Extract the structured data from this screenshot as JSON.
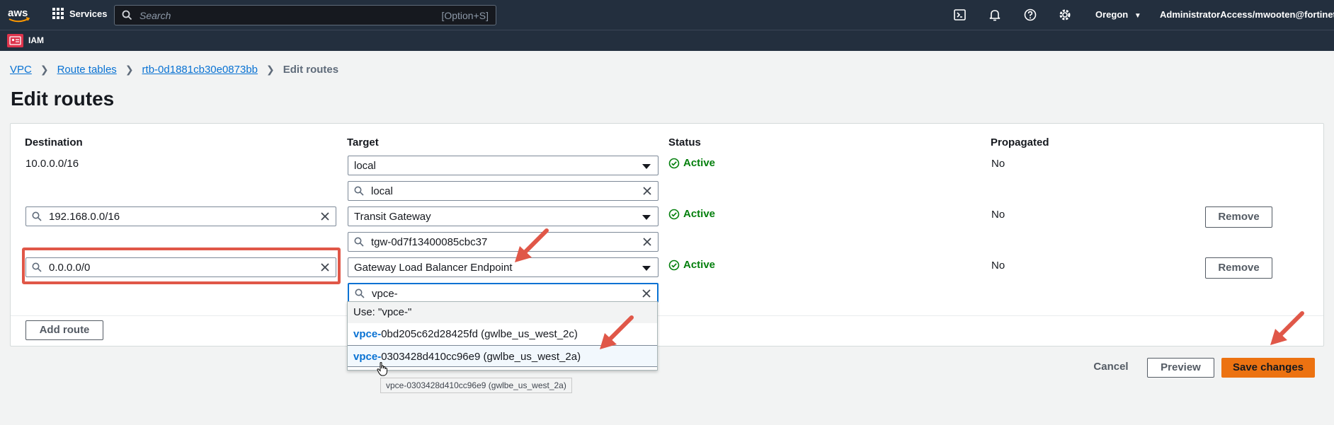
{
  "topnav": {
    "logo_text": "aws",
    "services_label": "Services",
    "search_placeholder": "Search",
    "search_shortcut": "[Option+S]",
    "region": "Oregon",
    "account": "AdministratorAccess/mwooten@fortinet.com"
  },
  "subnav": {
    "service_label": "IAM"
  },
  "breadcrumb": {
    "items": [
      "VPC",
      "Route tables",
      "rtb-0d1881cb30e0873bb"
    ],
    "current": "Edit routes"
  },
  "page_title": "Edit routes",
  "table": {
    "headers": {
      "destination": "Destination",
      "target": "Target",
      "status": "Status",
      "propagated": "Propagated"
    },
    "rows": [
      {
        "destination": "10.0.0.0/16",
        "target": "local",
        "target_search": "local",
        "status": "Active",
        "propagated": "No"
      },
      {
        "destination": "192.168.0.0/16",
        "target": "Transit Gateway",
        "target_search": "tgw-0d7f13400085cbc37",
        "status": "Active",
        "propagated": "No",
        "remove_label": "Remove"
      },
      {
        "destination": "0.0.0.0/0",
        "target": "Gateway Load Balancer Endpoint",
        "target_search": "vpce-",
        "status": "Active",
        "propagated": "No",
        "remove_label": "Remove"
      }
    ],
    "add_route_label": "Add route"
  },
  "dropdown": {
    "use_option": "Use: \"vpce-\"",
    "options": [
      {
        "match": "vpce-",
        "rest": "0bd205c62d28425fd (gwlbe_us_west_2c)"
      },
      {
        "match": "vpce-",
        "rest": "0303428d410cc96e9 (gwlbe_us_west_2a)"
      }
    ]
  },
  "tooltip": "vpce-0303428d410cc96e9 (gwlbe_us_west_2a)",
  "footer": {
    "cancel": "Cancel",
    "preview": "Preview",
    "save": "Save changes"
  },
  "colors": {
    "accent": "#ec7211",
    "link": "#0972d3",
    "success": "#037f0c",
    "nav_bg": "#232f3e",
    "annotation": "#e05748"
  }
}
